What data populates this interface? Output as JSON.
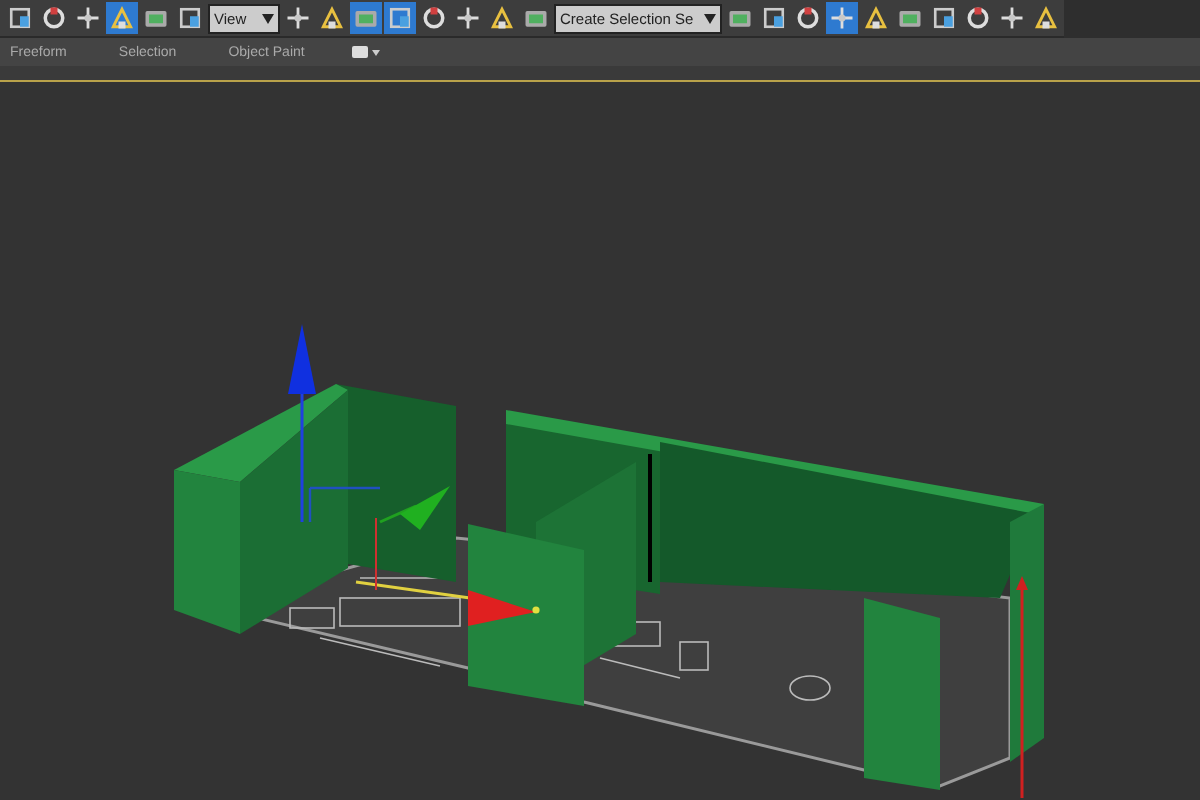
{
  "toolbar": {
    "buttons": [
      {
        "selected": false
      },
      {
        "selected": false
      },
      {
        "selected": false
      },
      {
        "selected": true
      },
      {
        "selected": false
      },
      {
        "selected": false
      }
    ],
    "view_dropdown": {
      "value": "View"
    },
    "tools": [
      {
        "selected": false
      },
      {
        "selected": false
      },
      {
        "selected": true
      },
      {
        "selected": true
      },
      {
        "selected": false
      },
      {
        "selected": false
      },
      {
        "selected": false
      },
      {
        "selected": false
      }
    ],
    "selection_set_dropdown": {
      "value": "Create Selection Se"
    },
    "end_tools": [
      {
        "selected": false
      },
      {
        "selected": false
      },
      {
        "selected": false
      },
      {
        "selected": true
      },
      {
        "selected": false
      },
      {
        "selected": false
      },
      {
        "selected": false
      },
      {
        "selected": false
      },
      {
        "selected": false
      },
      {
        "selected": false
      }
    ]
  },
  "ribbon": {
    "tabs": [
      {
        "label": "Freeform"
      },
      {
        "label": "Selection"
      },
      {
        "label": "Object Paint"
      }
    ]
  }
}
